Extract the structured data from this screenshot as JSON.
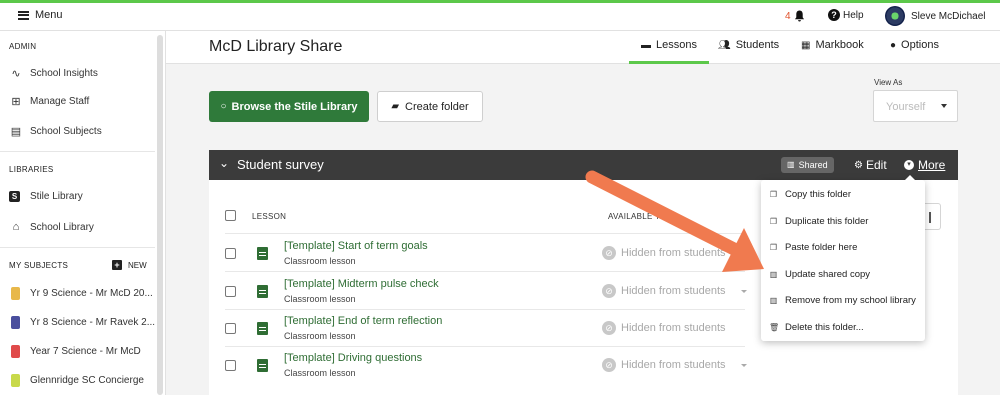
{
  "topbar": {
    "menu_label": "Menu",
    "notification_count": "4",
    "help_label": "Help",
    "user_name": "Sleve McDichael"
  },
  "sidebar": {
    "admin_heading": "ADMIN",
    "admin_items": [
      {
        "label": "School Insights",
        "icon": "pulse-icon"
      },
      {
        "label": "Manage Staff",
        "icon": "staff-icon"
      },
      {
        "label": "School Subjects",
        "icon": "books-icon"
      }
    ],
    "libraries_heading": "LIBRARIES",
    "library_items": [
      {
        "label": "Stile Library",
        "icon": "stile-logo-icon"
      },
      {
        "label": "School Library",
        "icon": "school-icon"
      }
    ],
    "subjects_heading": "MY SUBJECTS",
    "new_label": "NEW",
    "subjects": [
      {
        "label": "Yr 9 Science - Mr McD 20...",
        "color": "#e8b84a"
      },
      {
        "label": "Yr 8 Science - Mr Ravek 2...",
        "color": "#4a4f9e"
      },
      {
        "label": "Year 7 Science - Mr McD",
        "color": "#e04a4a"
      },
      {
        "label": "Glennridge SC Concierge",
        "color": "#c8d94a"
      }
    ]
  },
  "header": {
    "title": "McD Library Share",
    "tabs": [
      {
        "label": "Lessons",
        "icon": "folder-icon"
      },
      {
        "label": "Students",
        "icon": "people-icon"
      },
      {
        "label": "Markbook",
        "icon": "grid-icon"
      },
      {
        "label": "Options",
        "icon": "gear-circle-icon"
      }
    ]
  },
  "toolbar": {
    "browse_label": "Browse the Stile Library",
    "create_label": "Create folder",
    "view_as_label": "View As",
    "view_as_value": "Yourself"
  },
  "folder": {
    "name": "Student survey",
    "shared_label": "Shared",
    "edit_label": "Edit",
    "more_label": "More"
  },
  "table": {
    "col_lesson": "LESSON",
    "col_available": "AVAILABLE T",
    "rows": [
      {
        "title": "[Template] Start of term goals",
        "type": "Classroom lesson",
        "status": "Hidden from students"
      },
      {
        "title": "[Template] Midterm pulse check",
        "type": "Classroom lesson",
        "status": "Hidden from students"
      },
      {
        "title": "[Template] End of term reflection",
        "type": "Classroom lesson",
        "status": "Hidden from students"
      },
      {
        "title": "[Template] Driving questions",
        "type": "Classroom lesson",
        "status": "Hidden from students"
      }
    ]
  },
  "dropdown": {
    "items": [
      {
        "label": "Copy this folder",
        "icon": "copy-icon"
      },
      {
        "label": "Duplicate this folder",
        "icon": "duplicate-icon"
      },
      {
        "label": "Paste folder here",
        "icon": "paste-icon"
      },
      {
        "label": "Update shared copy",
        "icon": "library-icon"
      },
      {
        "label": "Remove from my school library",
        "icon": "library-remove-icon"
      },
      {
        "label": "Delete this folder...",
        "icon": "trash-icon"
      }
    ]
  },
  "colors": {
    "accent_green": "#5cc84a",
    "primary_button": "#2f7a3a",
    "folder_bar": "#3b3b3b",
    "annotation_arrow": "#f07a4f"
  }
}
